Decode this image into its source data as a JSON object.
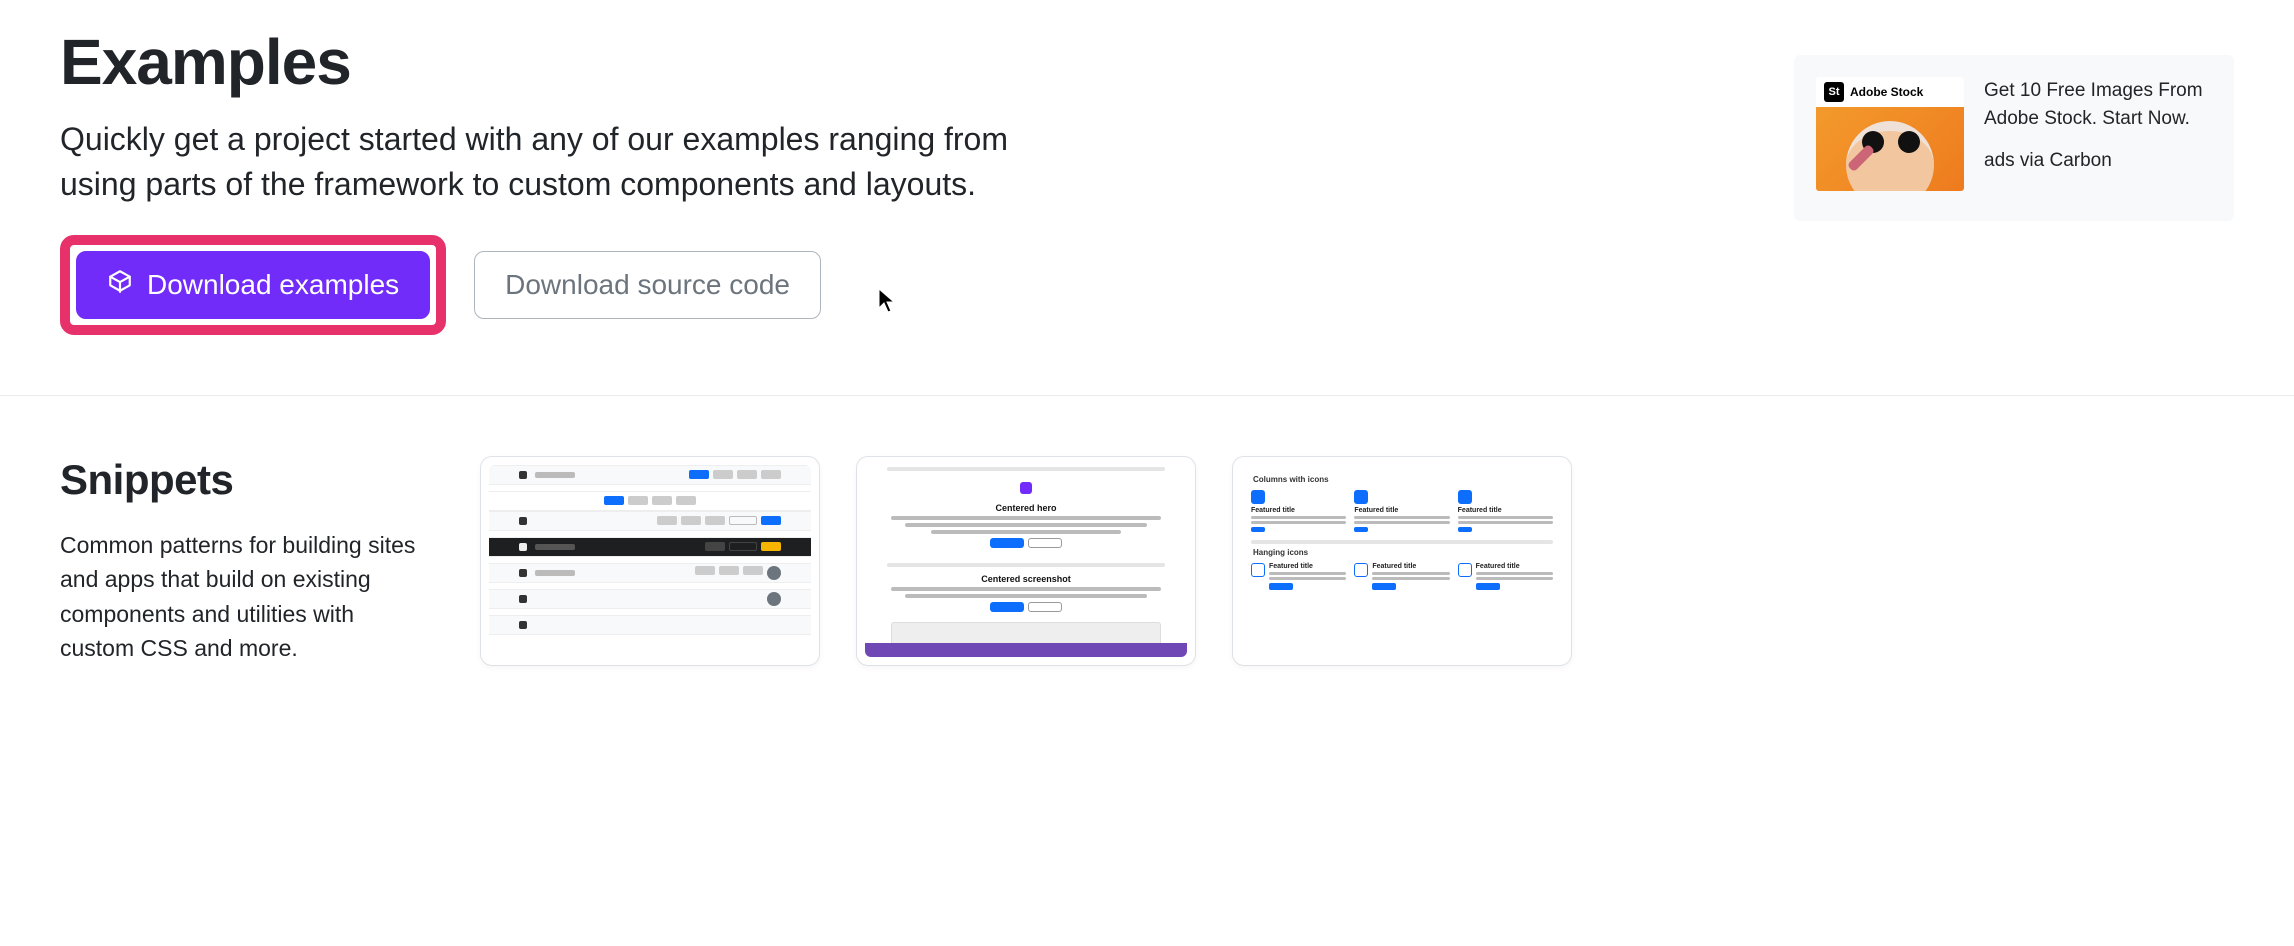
{
  "hero": {
    "title": "Examples",
    "lead": "Quickly get a project started with any of our examples ranging from using parts of the framework to custom components and layouts.",
    "download_examples_label": "Download examples",
    "download_source_label": "Download source code"
  },
  "ad": {
    "brand_label": "Adobe Stock",
    "badge": "St",
    "text": "Get 10 Free Images From Adobe Stock. Start Now.",
    "via": "ads via Carbon"
  },
  "snippets": {
    "title": "Snippets",
    "lead": "Common patterns for building sites and apps that build on existing components and utilities with custom CSS and more.",
    "card2": {
      "heading1": "Centered hero",
      "heading2": "Centered screenshot"
    },
    "card3": {
      "section1": "Columns with icons",
      "section2": "Hanging icons",
      "feature": "Featured title"
    }
  }
}
